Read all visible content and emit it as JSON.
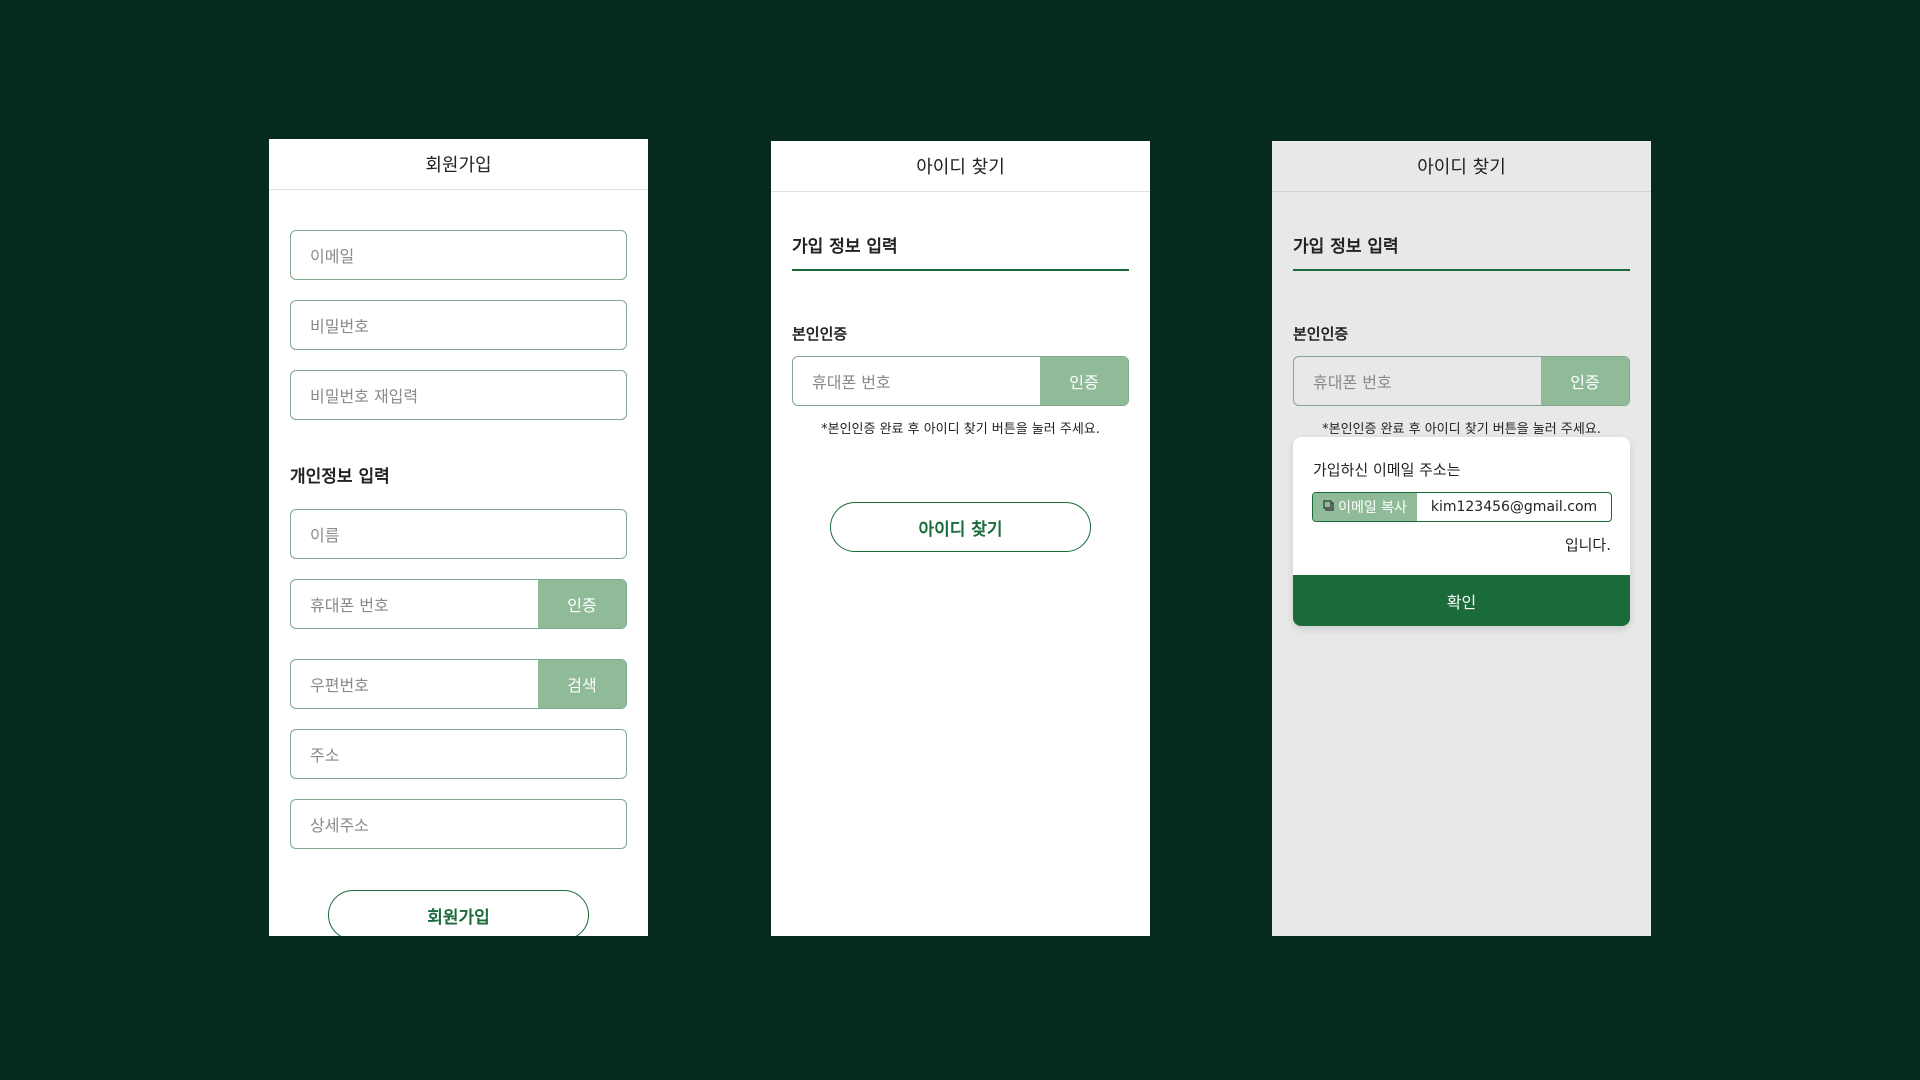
{
  "signup": {
    "title": "회원가입",
    "email_placeholder": "이메일",
    "password_placeholder": "비밀번호",
    "password_confirm_placeholder": "비밀번호 재입력",
    "personal_section": "개인정보 입력",
    "name_placeholder": "이름",
    "phone_placeholder": "휴대폰 번호",
    "verify_label": "인증",
    "zipcode_placeholder": "우편번호",
    "search_label": "검색",
    "address_placeholder": "주소",
    "address_detail_placeholder": "상세주소",
    "submit_label": "회원가입"
  },
  "find_id": {
    "title": "아이디 찾기",
    "tab_title": "가입 정보 입력",
    "verification_label": "본인인증",
    "phone_placeholder": "휴대폰 번호",
    "verify_label": "인증",
    "hint": "*본인인증 완료 후 아이디 찾기 버튼을 눌러 주세요.",
    "submit_label": "아이디 찾기"
  },
  "find_id_result": {
    "title": "아이디 찾기",
    "tab_title": "가입 정보 입력",
    "verification_label": "본인인증",
    "phone_placeholder": "휴대폰 번호",
    "verify_label": "인증",
    "hint": "*본인인증 완료 후 아이디 찾기 버튼을 눌러 주세요.",
    "popup": {
      "message": "가입하신 이메일 주소는",
      "copy_label": "이메일 복사",
      "copy_icon": "copy-icon",
      "email": "kim123456@gmail.com",
      "suffix": "입니다.",
      "confirm_label": "확인"
    }
  },
  "colors": {
    "background": "#062a20",
    "accent": "#1b6b3a",
    "accent_light": "#8fbb99",
    "border": "#7fa88d"
  }
}
